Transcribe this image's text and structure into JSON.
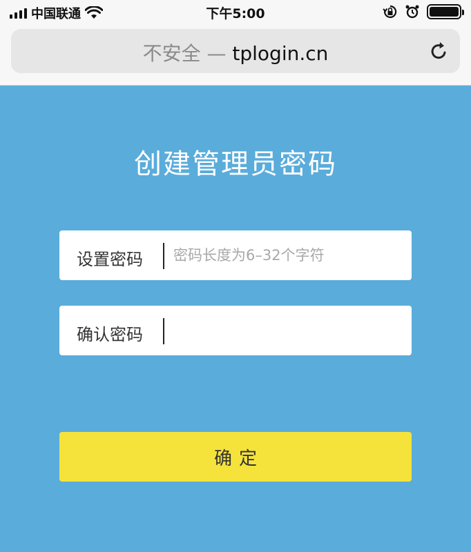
{
  "status_bar": {
    "carrier": "中国联通",
    "time": "下午5:00"
  },
  "browser": {
    "security_label": "不安全 — ",
    "host": "tplogin.cn"
  },
  "page": {
    "title": "创建管理员密码",
    "set_password": {
      "label": "设置密码",
      "value": "",
      "placeholder": "密码长度为6–32个字符"
    },
    "confirm_password": {
      "label": "确认密码",
      "value": "",
      "placeholder": ""
    },
    "confirm_button_label": "确定"
  },
  "colors": {
    "page_background": "#5aacdb",
    "button_background": "#f5e33b"
  }
}
